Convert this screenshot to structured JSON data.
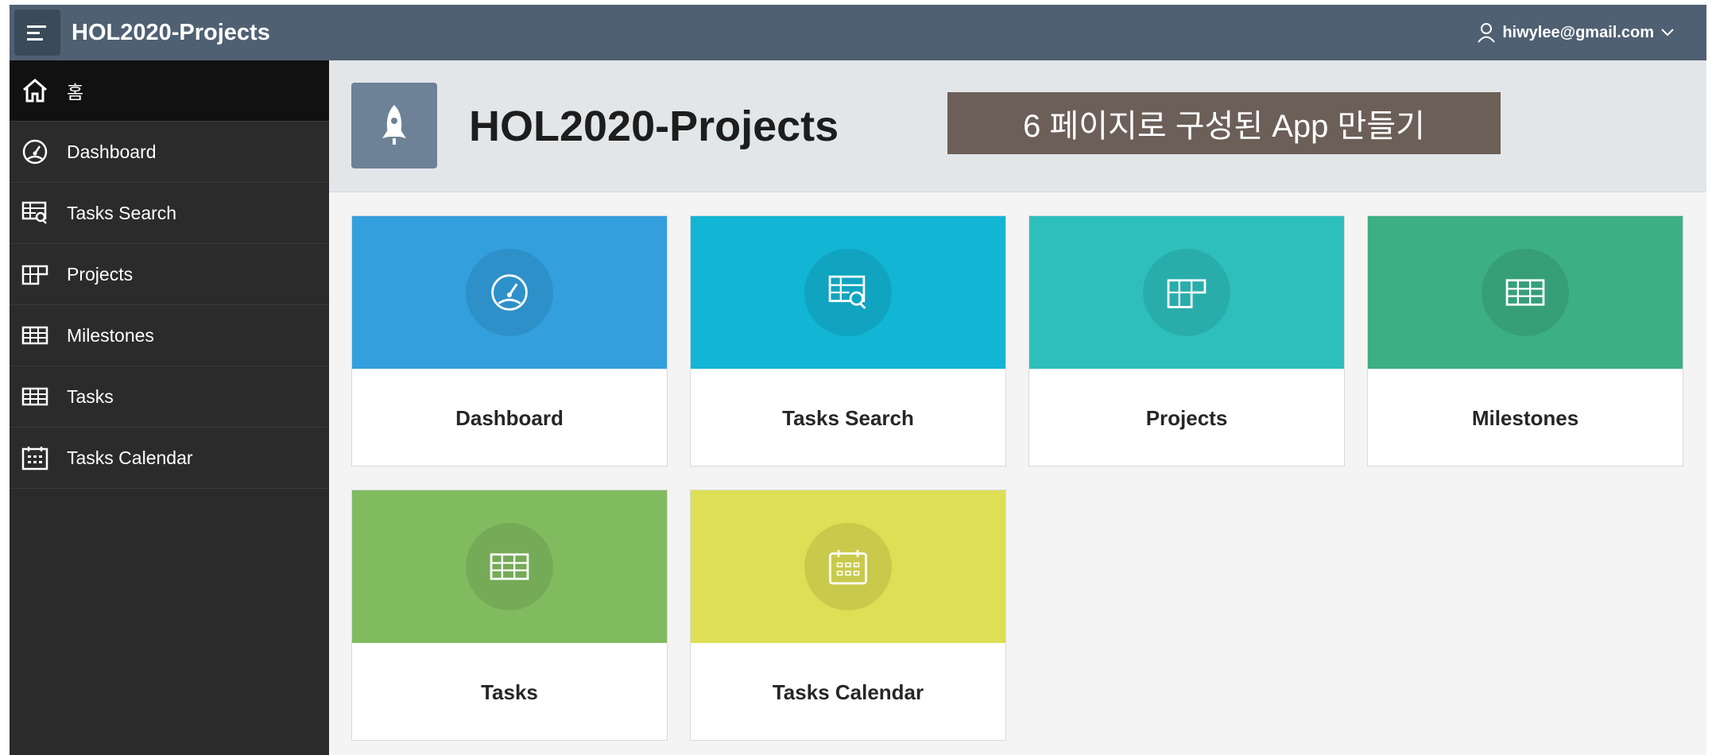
{
  "header": {
    "app_title": "HOL2020-Projects",
    "user_email": "hiwylee@gmail.com",
    "menu_icon": "hamburger-icon",
    "user_icon": "user-icon",
    "chevron_icon": "chevron-down-icon"
  },
  "sidebar": {
    "items": [
      {
        "label": "홈",
        "icon": "home-icon",
        "active": true
      },
      {
        "label": "Dashboard",
        "icon": "dashboard-gauge-icon"
      },
      {
        "label": "Tasks Search",
        "icon": "table-search-icon"
      },
      {
        "label": "Projects",
        "icon": "table-grid-icon"
      },
      {
        "label": "Milestones",
        "icon": "table-icon"
      },
      {
        "label": "Tasks",
        "icon": "table-icon"
      },
      {
        "label": "Tasks Calendar",
        "icon": "calendar-icon"
      }
    ]
  },
  "hero": {
    "title": "HOL2020-Projects",
    "icon": "rocket-icon",
    "banner": "6 페이지로 구성된 App 만들기"
  },
  "cards": [
    {
      "label": "Dashboard",
      "color": "#339fdd",
      "icon": "dashboard-gauge-icon"
    },
    {
      "label": "Tasks Search",
      "color": "#12b5d4",
      "icon": "table-search-icon"
    },
    {
      "label": "Projects",
      "color": "#2ebfbc",
      "icon": "table-grid-icon"
    },
    {
      "label": "Milestones",
      "color": "#3caf85",
      "icon": "table-icon"
    },
    {
      "label": "Tasks",
      "color": "#81bb5f",
      "icon": "table-icon"
    },
    {
      "label": "Tasks Calendar",
      "color": "#dddf54",
      "icon": "calendar-icon"
    }
  ],
  "colors": {
    "header_bg": "#4f6072",
    "sidebar_bg": "#2b2b2b",
    "sidebar_active_bg": "#111111",
    "hero_bg": "#e3e6e9",
    "banner_bg": "#6b5f58"
  }
}
